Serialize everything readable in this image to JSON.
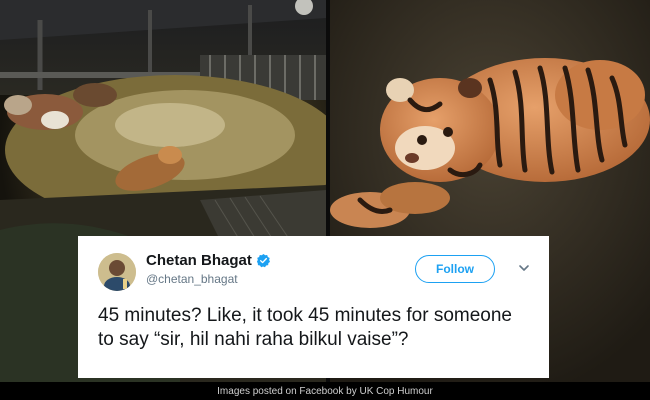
{
  "tweet": {
    "display_name": "Chetan Bhagat",
    "handle": "@chetan_bhagat",
    "follow_label": "Follow",
    "verified": true,
    "text": "45 minutes? Like, it took 45 minutes for someone to say “sir, hil nahi raha bilkul vaise”?"
  },
  "caption": "Images posted on Facebook by UK Cop Humour",
  "colors": {
    "accent": "#1da1f2",
    "text": "#14171a",
    "muted": "#657786",
    "caption_bg": "#000000"
  },
  "icons": {
    "verified": "verified-badge-icon",
    "more": "chevron-down-icon"
  }
}
